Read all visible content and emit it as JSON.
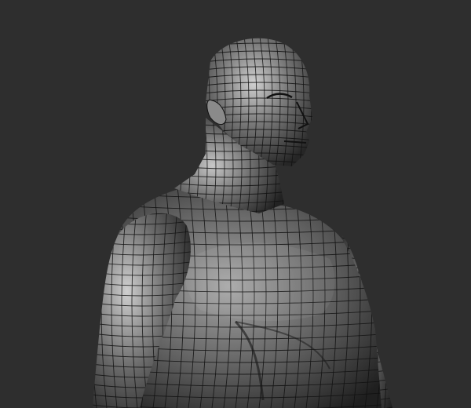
{
  "scene": {
    "background_color": "#2e2e2e",
    "model": "male-torso-wireframe",
    "mesh_fill": "#6f6f6f",
    "mesh_highlight": "#d8d8d8",
    "mesh_shadow": "#1c1c1c",
    "wire_color": "#111111"
  }
}
